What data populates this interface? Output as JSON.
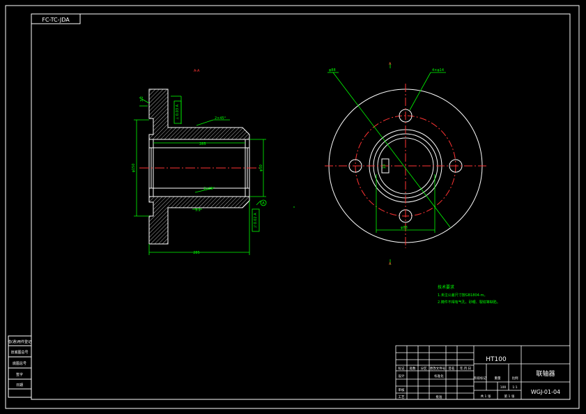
{
  "drawing": {
    "code_box": "FC-TC-JDA",
    "section_label": "A-A",
    "view_arrow_top": "A",
    "view_arrow_bottom": "A",
    "bolt_circle_callout": "4×φ14",
    "hole_callout": "φ88",
    "keyway_width": "10",
    "bore_diameter": "φ50",
    "dims": {
      "chamfer_top": "2×45°",
      "chamfer_bottom": "2×45°",
      "inner_length": "285",
      "overall_height": "φ150",
      "overall_width": "285",
      "roughness_sym": "3.2",
      "gdt_top": "⊥ 0.03 A",
      "gdt_bottom": "// 0.02 A",
      "datum": "A",
      "pcd": "φ88",
      "side_label": "3.2"
    },
    "tech_requirements": {
      "title": "技术要求",
      "lines": [
        "1.未注公差尺寸按GB1804-m。",
        "2.铸件不得有气孔、砂眼、裂纹等缺陷。"
      ]
    }
  },
  "title_block": {
    "material": "HT100",
    "part_name": "联轴器",
    "drawing_number": "WGJ-01-04",
    "rows_left": [
      "标记",
      "设计",
      "审核",
      "工艺"
    ],
    "header_cols": [
      "处数",
      "分区",
      "更改文件号",
      "签名",
      "年.月.日"
    ],
    "std": "标准化",
    "approve": "批准",
    "stage_label": "阶段标记",
    "weight_label": "重量",
    "scale_label": "比例",
    "scale_value": "1:1",
    "weight_value": "100",
    "sheets": "共 1 张",
    "sheet_no": "第 1 张"
  },
  "side_strip": {
    "items": [
      "借(通)用件登记",
      "旧底图总号",
      "底图总号",
      "签字",
      "日期"
    ]
  }
}
